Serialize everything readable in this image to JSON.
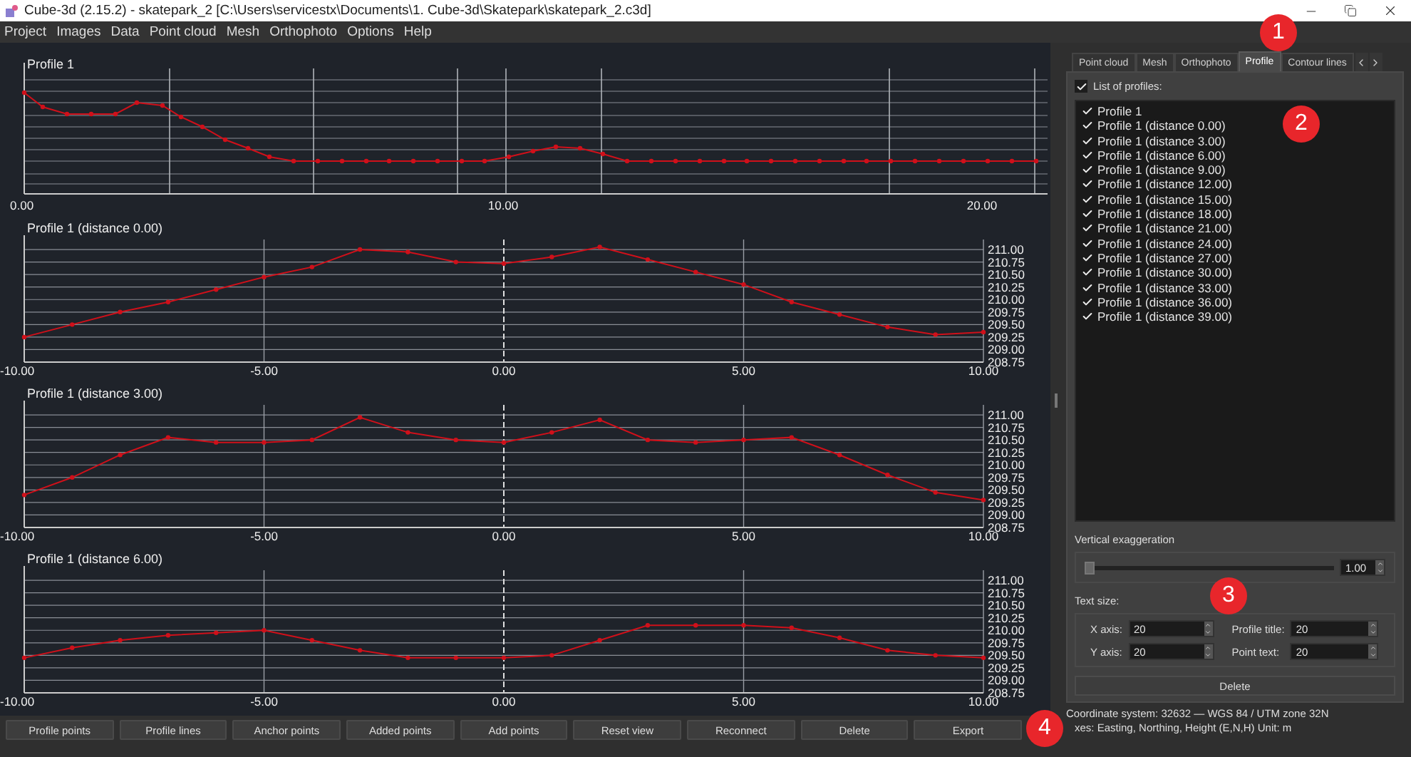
{
  "window": {
    "title": "Cube-3d (2.15.2) - skatepark_2 [C:\\Users\\servicestx\\Documents\\1. Cube-3d\\Skatepark\\skatepark_2.c3d]"
  },
  "menu": [
    "Project",
    "Images",
    "Data",
    "Point cloud",
    "Mesh",
    "Orthophoto",
    "Options",
    "Help"
  ],
  "overview": {
    "title": "Profile 1",
    "x_tick_labels": [
      "0.00",
      "10.00",
      "20.00"
    ]
  },
  "profiles": [
    {
      "chart_data": {
        "type": "line",
        "title": "Profile 1 (distance 0.00)",
        "x": [
          -10,
          -9,
          -8,
          -7,
          -6,
          -5,
          -4,
          -3,
          -2,
          -1,
          0,
          1,
          2,
          3,
          4,
          5,
          6,
          7,
          8,
          9,
          10
        ],
        "grid": true,
        "marker": "o",
        "ref_lines": [
          {
            "axis": "x",
            "value": 0
          }
        ],
        "series": [
          {
            "color": "#d0101a",
            "values": [
              209.25,
              209.5,
              209.75,
              209.95,
              210.2,
              210.45,
              210.65,
              211.0,
              210.95,
              210.75,
              210.72,
              210.85,
              211.05,
              210.8,
              210.55,
              210.3,
              209.95,
              209.7,
              209.45,
              209.3,
              209.35
            ]
          }
        ],
        "xlim": [
          -10,
          10
        ],
        "ylim": [
          208.75,
          211.2
        ],
        "xticks": [
          {
            "value": -10,
            "label": "-10.00"
          },
          {
            "value": -5,
            "label": "-5.00"
          },
          {
            "value": 0,
            "label": "0.00"
          },
          {
            "value": 5,
            "label": "5.00"
          },
          {
            "value": 10,
            "label": "10.00"
          }
        ],
        "yticks": [
          {
            "value": 211,
            "label": "211.00"
          },
          {
            "value": 210.75,
            "label": "210.75"
          },
          {
            "value": 210.5,
            "label": "210.50"
          },
          {
            "value": 210.25,
            "label": "210.25"
          },
          {
            "value": 210,
            "label": "210.00"
          },
          {
            "value": 209.75,
            "label": "209.75"
          },
          {
            "value": 209.5,
            "label": "209.50"
          },
          {
            "value": 209.25,
            "label": "209.25"
          },
          {
            "value": 209,
            "label": "209.00"
          },
          {
            "value": 208.75,
            "label": "208.75"
          }
        ]
      }
    },
    {
      "chart_data": {
        "type": "line",
        "title": "Profile 1 (distance 3.00)",
        "x": [
          -10,
          -9,
          -8,
          -7,
          -6,
          -5,
          -4,
          -3,
          -2,
          -1,
          0,
          1,
          2,
          3,
          4,
          5,
          6,
          7,
          8,
          9,
          10
        ],
        "grid": true,
        "marker": "o",
        "ref_lines": [
          {
            "axis": "x",
            "value": 0
          }
        ],
        "series": [
          {
            "color": "#d0101a",
            "values": [
              209.4,
              209.75,
              210.2,
              210.55,
              210.45,
              210.45,
              210.5,
              210.95,
              210.65,
              210.5,
              210.45,
              210.65,
              210.9,
              210.5,
              210.45,
              210.5,
              210.55,
              210.2,
              209.8,
              209.45,
              209.3
            ]
          }
        ],
        "xlim": [
          -10,
          10
        ],
        "ylim": [
          208.75,
          211.2
        ],
        "xticks": [
          {
            "value": -10,
            "label": "-10.00"
          },
          {
            "value": -5,
            "label": "-5.00"
          },
          {
            "value": 0,
            "label": "0.00"
          },
          {
            "value": 5,
            "label": "5.00"
          },
          {
            "value": 10,
            "label": "10.00"
          }
        ],
        "yticks": [
          {
            "value": 211,
            "label": "211.00"
          },
          {
            "value": 210.75,
            "label": "210.75"
          },
          {
            "value": 210.5,
            "label": "210.50"
          },
          {
            "value": 210.25,
            "label": "210.25"
          },
          {
            "value": 210,
            "label": "210.00"
          },
          {
            "value": 209.75,
            "label": "209.75"
          },
          {
            "value": 209.5,
            "label": "209.50"
          },
          {
            "value": 209.25,
            "label": "209.25"
          },
          {
            "value": 209,
            "label": "209.00"
          },
          {
            "value": 208.75,
            "label": "208.75"
          }
        ]
      }
    },
    {
      "chart_data": {
        "type": "line",
        "title": "Profile 1 (distance 6.00)",
        "x": [
          -10,
          -9,
          -8,
          -7,
          -6,
          -5,
          -4,
          -3,
          -2,
          -1,
          0,
          1,
          2,
          3,
          4,
          5,
          6,
          7,
          8,
          9,
          10
        ],
        "grid": true,
        "marker": "o",
        "ref_lines": [
          {
            "axis": "x",
            "value": 0
          }
        ],
        "series": [
          {
            "color": "#d0101a",
            "values": [
              209.45,
              209.65,
              209.8,
              209.9,
              209.95,
              210.0,
              209.8,
              209.6,
              209.45,
              209.45,
              209.45,
              209.5,
              209.8,
              210.1,
              210.1,
              210.1,
              210.05,
              209.85,
              209.6,
              209.5,
              209.45
            ]
          }
        ],
        "xlim": [
          -10,
          10
        ],
        "ylim": [
          208.75,
          211.2
        ],
        "xticks": [
          {
            "value": -10,
            "label": "-10.00"
          },
          {
            "value": -5,
            "label": "-5.00"
          },
          {
            "value": 0,
            "label": "0.00"
          },
          {
            "value": 5,
            "label": "5.00"
          },
          {
            "value": 10,
            "label": "10.00"
          }
        ],
        "yticks": [
          {
            "value": 211,
            "label": "211.00"
          },
          {
            "value": 210.75,
            "label": "210.75"
          },
          {
            "value": 210.5,
            "label": "210.50"
          },
          {
            "value": 210.25,
            "label": "210.25"
          },
          {
            "value": 210,
            "label": "210.00"
          },
          {
            "value": 209.75,
            "label": "209.75"
          },
          {
            "value": 209.5,
            "label": "209.50"
          },
          {
            "value": 209.25,
            "label": "209.25"
          },
          {
            "value": 209,
            "label": "209.00"
          },
          {
            "value": 208.75,
            "label": "208.75"
          }
        ]
      }
    }
  ],
  "buttons": [
    "Profile points",
    "Profile lines",
    "Anchor points",
    "Added points",
    "Add points",
    "Reset view",
    "Reconnect",
    "Delete",
    "Export"
  ],
  "tabs": [
    {
      "label": "Point cloud",
      "selected": false
    },
    {
      "label": "Mesh",
      "selected": false
    },
    {
      "label": "Orthophoto",
      "selected": false
    },
    {
      "label": "Profile",
      "selected": true
    },
    {
      "label": "Contour lines",
      "selected": false
    }
  ],
  "profile_list": {
    "label": "List of profiles:",
    "checked": true,
    "items": [
      {
        "label": "Profile 1",
        "checked": true
      },
      {
        "label": "Profile 1 (distance 0.00)",
        "checked": true
      },
      {
        "label": "Profile 1 (distance 3.00)",
        "checked": true
      },
      {
        "label": "Profile 1 (distance 6.00)",
        "checked": true
      },
      {
        "label": "Profile 1 (distance 9.00)",
        "checked": true
      },
      {
        "label": "Profile 1 (distance 12.00)",
        "checked": true
      },
      {
        "label": "Profile 1 (distance 15.00)",
        "checked": true
      },
      {
        "label": "Profile 1 (distance 18.00)",
        "checked": true
      },
      {
        "label": "Profile 1 (distance 21.00)",
        "checked": true
      },
      {
        "label": "Profile 1 (distance 24.00)",
        "checked": true
      },
      {
        "label": "Profile 1 (distance 27.00)",
        "checked": true
      },
      {
        "label": "Profile 1 (distance 30.00)",
        "checked": true
      },
      {
        "label": "Profile 1 (distance 33.00)",
        "checked": true
      },
      {
        "label": "Profile 1 (distance 36.00)",
        "checked": true
      },
      {
        "label": "Profile 1 (distance 39.00)",
        "checked": true
      }
    ]
  },
  "vertical_exaggeration": {
    "label": "Vertical exaggeration",
    "level": 0,
    "value": "1.00"
  },
  "text_size": {
    "label": "Text size:",
    "fields": [
      {
        "label": "X axis:",
        "value": "20"
      },
      {
        "label": "Profile title:",
        "value": "20"
      },
      {
        "label": "Y axis:",
        "value": "20"
      },
      {
        "label": "Point text:",
        "value": "20"
      }
    ]
  },
  "delete_button": "Delete",
  "status": [
    "Coordinate system: 32632 — WGS 84 / UTM zone 32N",
    "xes: Easting, Northing, Height (E,N,H) Unit: m"
  ],
  "callouts": [
    "1",
    "2",
    "3",
    "4"
  ]
}
